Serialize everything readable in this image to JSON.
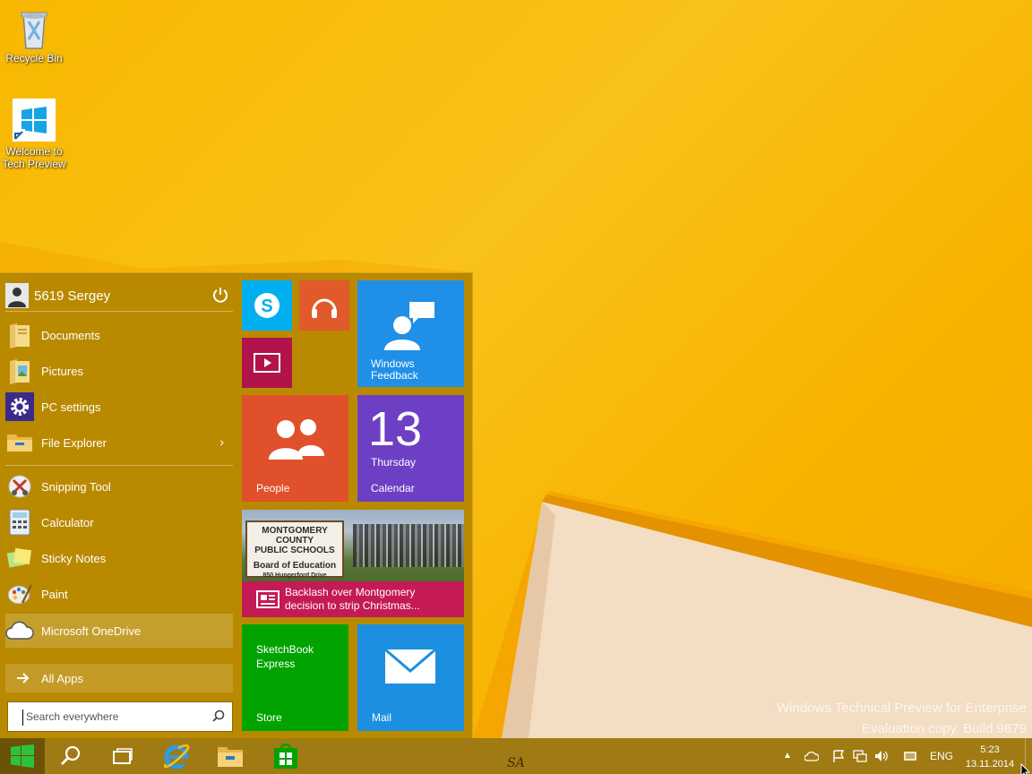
{
  "desktop": {
    "icons": [
      {
        "label": "Recycle Bin",
        "icon": "recycle-bin-icon"
      },
      {
        "label": "Welcome to Tech Preview",
        "icon": "windows-logo-icon"
      }
    ],
    "watermark": {
      "line1": "Windows Technical Preview for Enterprise",
      "line2": "Evaluation copy. Build 9879"
    }
  },
  "start_menu": {
    "user_name": "5619 Sergey",
    "pinned": [
      {
        "label": "Documents",
        "icon": "documents-icon"
      },
      {
        "label": "Pictures",
        "icon": "pictures-icon"
      },
      {
        "label": "PC settings",
        "icon": "gear-icon"
      },
      {
        "label": "File Explorer",
        "icon": "folder-icon"
      }
    ],
    "recent": [
      {
        "label": "Snipping Tool",
        "icon": "snipping-tool-icon"
      },
      {
        "label": "Calculator",
        "icon": "calculator-icon"
      },
      {
        "label": "Sticky Notes",
        "icon": "sticky-notes-icon"
      },
      {
        "label": "Paint",
        "icon": "paint-icon"
      },
      {
        "label": "Microsoft OneDrive",
        "icon": "cloud-icon"
      }
    ],
    "all_apps_label": "All Apps",
    "search_placeholder": "Search everywhere",
    "tiles": {
      "windows_feedback": {
        "line1": "Windows",
        "line2": "Feedback"
      },
      "people": {
        "label": "People"
      },
      "calendar": {
        "day": "13",
        "weekday": "Thursday",
        "label": "Calendar"
      },
      "news": {
        "headline1": "Backlash over Montgomery",
        "headline2": "decision to strip Christmas...",
        "sign_line1": "MONTGOMERY COUNTY",
        "sign_line2": "PUBLIC SCHOOLS",
        "sign_line3": "Board of Education",
        "sign_line4": "850 Hungerford Drive"
      },
      "sketchbook": {
        "line1": "SketchBook",
        "line2": "Express",
        "label": "Store"
      },
      "mail": {
        "label": "Mail"
      }
    },
    "colors": {
      "menu_bg": "#b98a00",
      "skype": "#00aff0",
      "music": "#e05a2b",
      "video": "#b0144a",
      "feedback": "#1f8fe8",
      "people": "#e0502a",
      "calendar": "#6c3fc4",
      "news_band": "#c41a56",
      "store": "#00a300",
      "mail": "#1c8fe0"
    }
  },
  "taskbar": {
    "apps": [
      "start-icon",
      "search-icon",
      "task-view-icon",
      "internet-explorer-icon",
      "file-explorer-icon",
      "store-icon"
    ],
    "language": "ENG",
    "time": "5:23",
    "date": "13.11.2014",
    "signature": "SA"
  }
}
